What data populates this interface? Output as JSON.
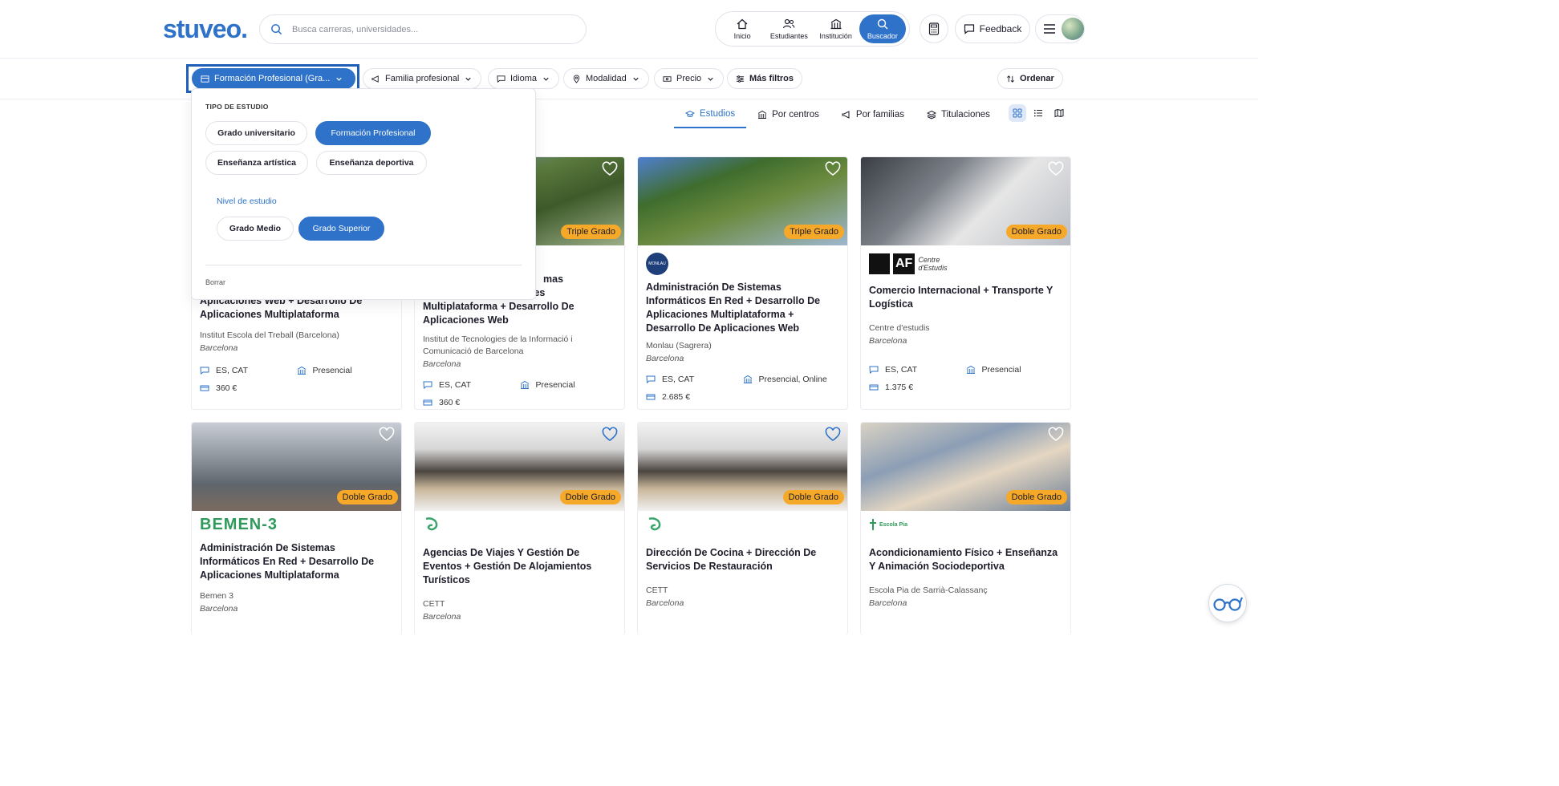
{
  "header": {
    "logo": "stuveo.",
    "search_placeholder": "Busca carreras, universidades...",
    "nav": [
      {
        "label": "Inicio"
      },
      {
        "label": "Estudiantes"
      },
      {
        "label": "Institución"
      },
      {
        "label": "Buscador",
        "active": true
      }
    ],
    "feedback_label": "Feedback"
  },
  "filters": {
    "tipo": "Formación Profesional (Gra...",
    "familia": "Familia profesional",
    "idioma": "Idioma",
    "modalidad": "Modalidad",
    "precio": "Precio",
    "mas": "Más filtros",
    "ordenar": "Ordenar"
  },
  "tabs": [
    {
      "label": "Estudios",
      "active": true
    },
    {
      "label": "Por centros"
    },
    {
      "label": "Por familias"
    },
    {
      "label": "Titulaciones"
    }
  ],
  "dropdown": {
    "section_title": "TIPO DE ESTUDIO",
    "types": [
      "Grado universitario",
      "Formación Profesional",
      "Enseñanza artística",
      "Enseñanza deportiva"
    ],
    "selected_type": "Formación Profesional",
    "level_title": "Nivel de estudio",
    "levels": [
      "Grado Medio",
      "Grado Superior"
    ],
    "selected_level": "Grado Superior",
    "clear_label": "Borrar"
  },
  "cards": [
    {
      "badge": "",
      "title": "Aplicaciones Web + Desarrollo De Aplicaciones Multiplataforma",
      "school": "Institut Escola del Treball (Barcelona)",
      "city": "Barcelona",
      "lang": "ES, CAT",
      "mode": "Presencial",
      "price": "360 €"
    },
    {
      "badge": "Triple Grado",
      "title_partial": "mas",
      "title": "esarrollo De Aplicaciones Multiplataforma + Desarrollo De Aplicaciones Web",
      "school": "Institut de Tecnologies de la Informació i Comunicació de Barcelona",
      "city": "Barcelona",
      "lang": "ES, CAT",
      "mode": "Presencial",
      "price": "360 €"
    },
    {
      "badge": "Triple Grado",
      "title": "Administración De Sistemas Informáticos En Red + Desarrollo De Aplicaciones Multiplataforma + Desarrollo De Aplicaciones Web",
      "school": "Monlau (Sagrera)",
      "city": "Barcelona",
      "lang": "ES, CAT",
      "mode": "Presencial, Online",
      "price": "2.685 €",
      "logo_text": "MONLAU"
    },
    {
      "badge": "Doble Grado",
      "title": "Comercio Internacional + Transporte Y Logística",
      "school": "Centre d'estudis",
      "city": "Barcelona",
      "lang": "ES, CAT",
      "mode": "Presencial",
      "price": "1.375 €",
      "logo_text": "AF",
      "logo_sub": "Centre d'Estudis"
    },
    {
      "badge": "Doble Grado",
      "title": "Administración De Sistemas Informáticos En Red + Desarrollo De Aplicaciones Multiplataforma",
      "school": "Bemen 3",
      "city": "Barcelona",
      "logo_text": "BEMEN-3"
    },
    {
      "badge": "Doble Grado",
      "title": "Agencias De Viajes Y Gestión De Eventos + Gestión De Alojamientos Turísticos",
      "school": "CETT",
      "city": "Barcelona"
    },
    {
      "badge": "Doble Grado",
      "title": "Dirección De Cocina + Dirección De Servicios De Restauración",
      "school": "CETT",
      "city": "Barcelona"
    },
    {
      "badge": "Doble Grado",
      "title": "Acondicionamiento Físico + Enseñanza Y Animación Sociodeportiva",
      "school": "Escola Pia de Sarrià-Calassanç",
      "city": "Barcelona",
      "logo_text": "Escola Pia"
    }
  ],
  "colors": {
    "brand": "#2e72c9",
    "badge": "#f6a928",
    "focus": "#1f5fb8"
  }
}
